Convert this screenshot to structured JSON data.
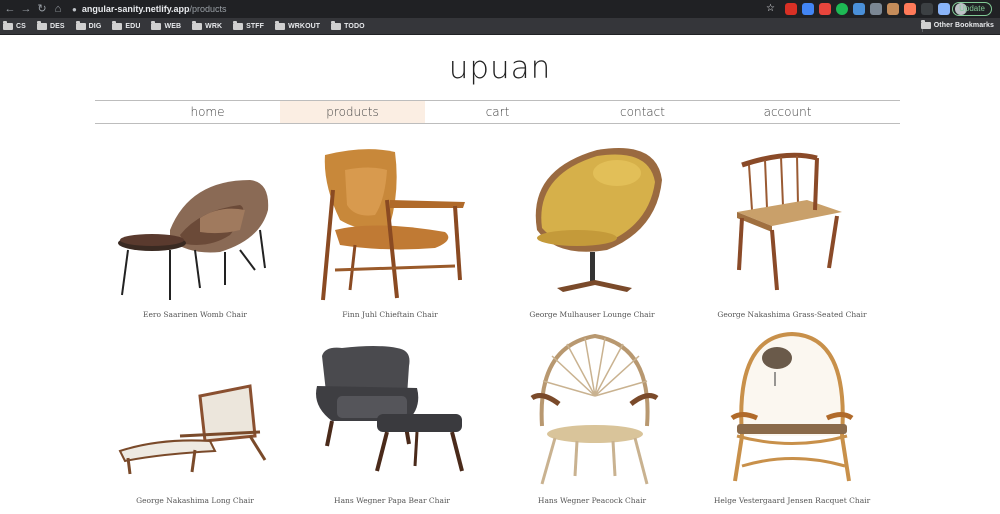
{
  "browser": {
    "url_host": "angular-sanity.netlify.app",
    "url_path": "/products",
    "update_label": "Update",
    "bookmarks": [
      "CS",
      "DES",
      "DIG",
      "EDU",
      "WEB",
      "WRK",
      "STFF",
      "WRKOUT",
      "TODO"
    ],
    "other_bookmarks": "Other Bookmarks"
  },
  "site": {
    "logo": "upuan",
    "nav": [
      "home",
      "products",
      "cart",
      "contact",
      "account"
    ],
    "active_nav": "products"
  },
  "products": [
    {
      "name": "Eero Saarinen Womb Chair"
    },
    {
      "name": "Finn Juhl Chieftain Chair"
    },
    {
      "name": "George Mulhauser Lounge Chair"
    },
    {
      "name": "George Nakashima Grass-Seated Chair"
    },
    {
      "name": "George Nakashima Long Chair"
    },
    {
      "name": "Hans Wegner Papa Bear Chair"
    },
    {
      "name": "Hans Wegner Peacock Chair"
    },
    {
      "name": "Helge Vestergaard Jensen Racquet Chair"
    }
  ]
}
